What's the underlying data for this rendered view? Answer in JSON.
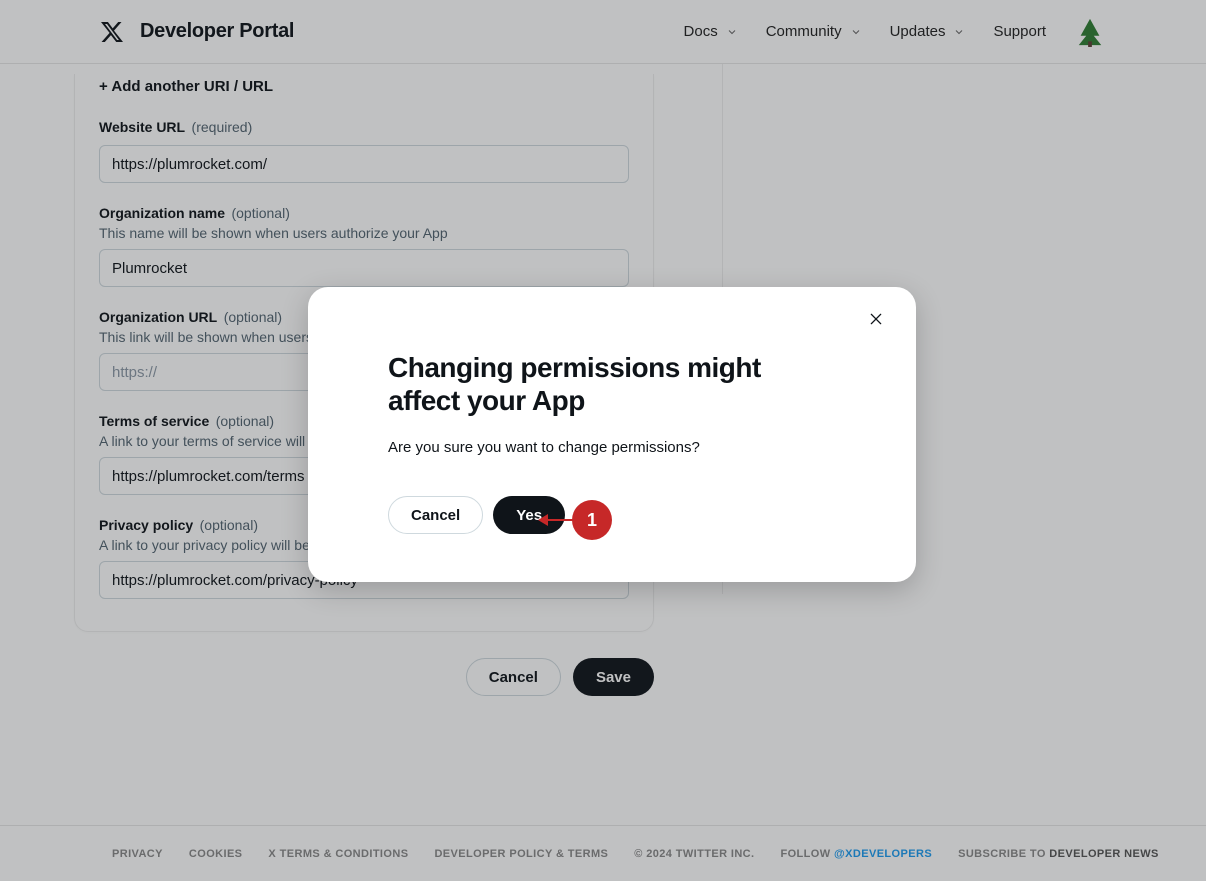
{
  "header": {
    "portal_title": "Developer Portal",
    "nav": {
      "docs": "Docs",
      "community": "Community",
      "updates": "Updates",
      "support": "Support"
    }
  },
  "form": {
    "add_uri_label": "+ Add another URI / URL",
    "website_url": {
      "label": "Website URL",
      "note": "(required)",
      "value": "https://plumrocket.com/"
    },
    "org_name": {
      "label": "Organization name",
      "note": "(optional)",
      "help": "This name will be shown when users authorize your App",
      "value": "Plumrocket"
    },
    "org_url": {
      "label": "Organization URL",
      "note": "(optional)",
      "help": "This link will be shown when users authorize your App",
      "placeholder": "https://",
      "value": ""
    },
    "tos": {
      "label": "Terms of service",
      "note": "(optional)",
      "help": "A link to your terms of service will be shown when users authorize your App",
      "value": "https://plumrocket.com/terms"
    },
    "privacy": {
      "label": "Privacy policy",
      "note": "(optional)",
      "help": "A link to your privacy policy will be shown when users authorize your App",
      "value": "https://plumrocket.com/privacy-policy"
    }
  },
  "page_actions": {
    "cancel": "Cancel",
    "save": "Save"
  },
  "modal": {
    "title": "Changing permissions might affect your App",
    "body": "Are you sure you want to change permissions?",
    "cancel": "Cancel",
    "yes": "Yes"
  },
  "callout": {
    "number": "1"
  },
  "footer": {
    "privacy": "PRIVACY",
    "cookies": "COOKIES",
    "xterms": "X TERMS & CONDITIONS",
    "devpolicy": "DEVELOPER POLICY & TERMS",
    "copyright": "© 2024 TWITTER INC.",
    "follow_prefix": "FOLLOW",
    "follow_handle": "@XDEVELOPERS",
    "subscribe_prefix": "SUBSCRIBE TO",
    "subscribe_label": "DEVELOPER NEWS"
  }
}
